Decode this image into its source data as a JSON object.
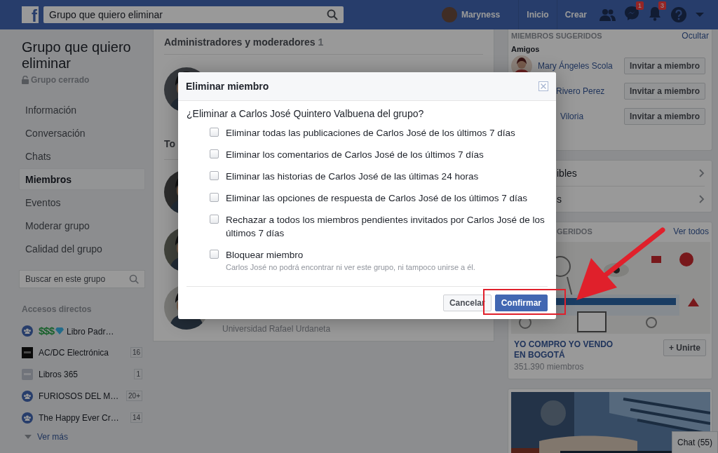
{
  "top_bar": {
    "logo": "f",
    "search": {
      "value": "Grupo que quiero eliminar"
    },
    "profile_name": "Maryness",
    "links": [
      "Inicio",
      "Crear"
    ],
    "message_badge": "1",
    "notification_badge": "3"
  },
  "sidebar": {
    "group_title": "Grupo que quiero eliminar",
    "privacy": "Grupo cerrado",
    "nav": [
      {
        "label": "Información",
        "selected": false
      },
      {
        "label": "Conversación",
        "selected": false
      },
      {
        "label": "Chats",
        "selected": false
      },
      {
        "label": "Miembros",
        "selected": true
      },
      {
        "label": "Eventos",
        "selected": false
      },
      {
        "label": "Moderar grupo",
        "selected": false
      },
      {
        "label": "Calidad del grupo",
        "selected": false
      }
    ],
    "search": {
      "placeholder": "Buscar en este grupo"
    },
    "shortcuts_title": "Accesos directos",
    "shortcuts": [
      {
        "kind": "group",
        "prefix": "$$$",
        "label": "Libro Padr…"
      },
      {
        "kind": "page",
        "label": "AC/DC Electrónica",
        "count": "16"
      },
      {
        "kind": "book",
        "label": "Libros 365",
        "count": "1"
      },
      {
        "kind": "group",
        "label": "FURIOSOS DEL M…",
        "count": "20+"
      },
      {
        "kind": "group",
        "label": "The Happy Ever Cr…",
        "count": "14"
      }
    ],
    "more": "Ver más"
  },
  "members": {
    "heading": "Administradores y moderadores",
    "count": "1",
    "section_fragment": "To",
    "member_subtitle": "Universidad Rafael Urdaneta"
  },
  "suggested_members": {
    "title": "MIEMBROS SUGERIDOS",
    "action": "Ocultar",
    "subtitle": "Amigos",
    "people": [
      {
        "name": "Mary Ángeles Scola",
        "button": "Invitar a miembro"
      },
      {
        "name": "Rivero Perez",
        "button": "Invitar a miembro"
      },
      {
        "name": "Viloria",
        "button": "Invitar a miembro"
      }
    ]
  },
  "links": [
    "ibles",
    "s"
  ],
  "suggested_groups": {
    "title_fragment": "GERIDOS",
    "action": "Ver todos",
    "name": "YO COMPRO YO VENDO EN BOGOTÁ",
    "members": "351.390 miembros",
    "button": "+ Unirte"
  },
  "chat": "Chat (55)",
  "dialog": {
    "title": "Eliminar miembro",
    "question": "¿Eliminar a Carlos José Quintero Valbuena del grupo?",
    "options": [
      {
        "label": "Eliminar todas las publicaciones de Carlos José de los últimos 7 días",
        "checked": false
      },
      {
        "label": "Eliminar los comentarios de Carlos José de los últimos 7 días",
        "checked": false
      },
      {
        "label": "Eliminar las historias de Carlos José de las últimas 24 horas",
        "checked": false
      },
      {
        "label": "Eliminar las opciones de respuesta de Carlos José de los últimos 7 días",
        "checked": false
      },
      {
        "label": "Rechazar a todos los miembros pendientes invitados por Carlos José de los últimos 7 días",
        "checked": false
      },
      {
        "label": "Bloquear miembro",
        "hint": "Carlos José no podrá encontrar ni ver este grupo, ni tampoco unirse a él.",
        "checked": false
      }
    ],
    "buttons": [
      {
        "label": "Cancelar",
        "kind": "secondary"
      },
      {
        "label": "Confirmar",
        "kind": "primary"
      }
    ]
  }
}
